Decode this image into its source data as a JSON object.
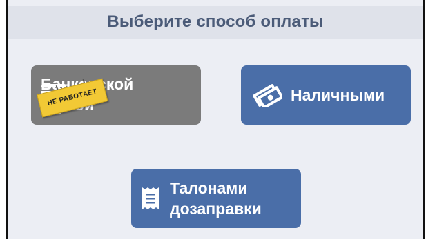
{
  "header": {
    "title": "Выберите способ оплаты"
  },
  "buttons": {
    "card": {
      "label": "Банковской\nкартой",
      "status_sticker": "НЕ РАБОТАЕТ",
      "icon": "credit-card-icon",
      "color": "#7b7b7b"
    },
    "cash": {
      "label": "Наличными",
      "icon": "cash-icon",
      "color": "#4a6ea8"
    },
    "coupons": {
      "label": "Талонами\nдозаправки",
      "icon": "receipt-icon",
      "color": "#4a6ea8"
    }
  },
  "colors": {
    "header_text": "#4b5b78",
    "header_bg": "#dfe2ea",
    "panel_bg": "#eceef4",
    "sticker_bg": "#f2c935"
  }
}
